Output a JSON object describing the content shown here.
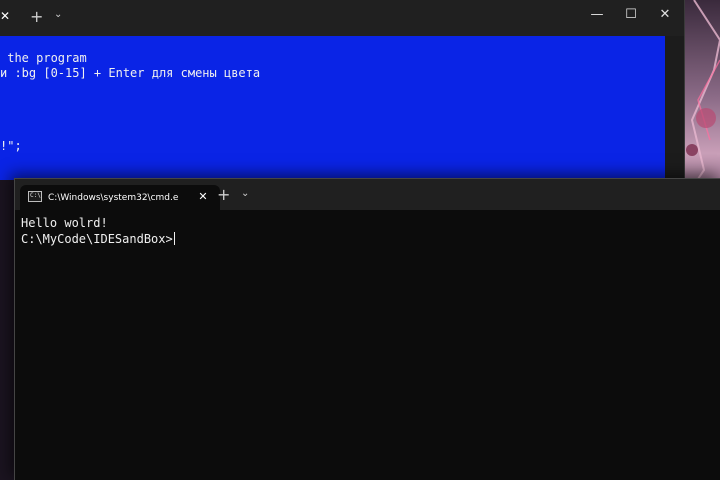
{
  "back_window": {
    "tab_close_glyph": "✕",
    "new_tab_glyph": "+",
    "dropdown_glyph": "⌄",
    "controls": {
      "minimize_glyph": "—",
      "maximize_glyph": "☐",
      "close_glyph": "✕"
    },
    "terminal_bg": "#0a24e6",
    "lines": [
      " the program",
      "и :bg [0-15] + Enter для смены цвета",
      "!\";"
    ]
  },
  "front_window": {
    "tab_icon_text": "C:\\",
    "tab_title": "C:\\Windows\\system32\\cmd.e",
    "tab_close_glyph": "✕",
    "new_tab_glyph": "+",
    "dropdown_glyph": "⌄",
    "terminal_bg": "#0c0c0c",
    "output_line": "Hello wolrd!",
    "prompt": "C:\\MyCode\\IDESandBox>"
  },
  "icons": {
    "tab_icon": "cmd-icon",
    "close": "close-icon",
    "add": "plus-icon",
    "dropdown": "chevron-down-icon",
    "minimize": "minimize-icon",
    "maximize": "maximize-icon"
  }
}
